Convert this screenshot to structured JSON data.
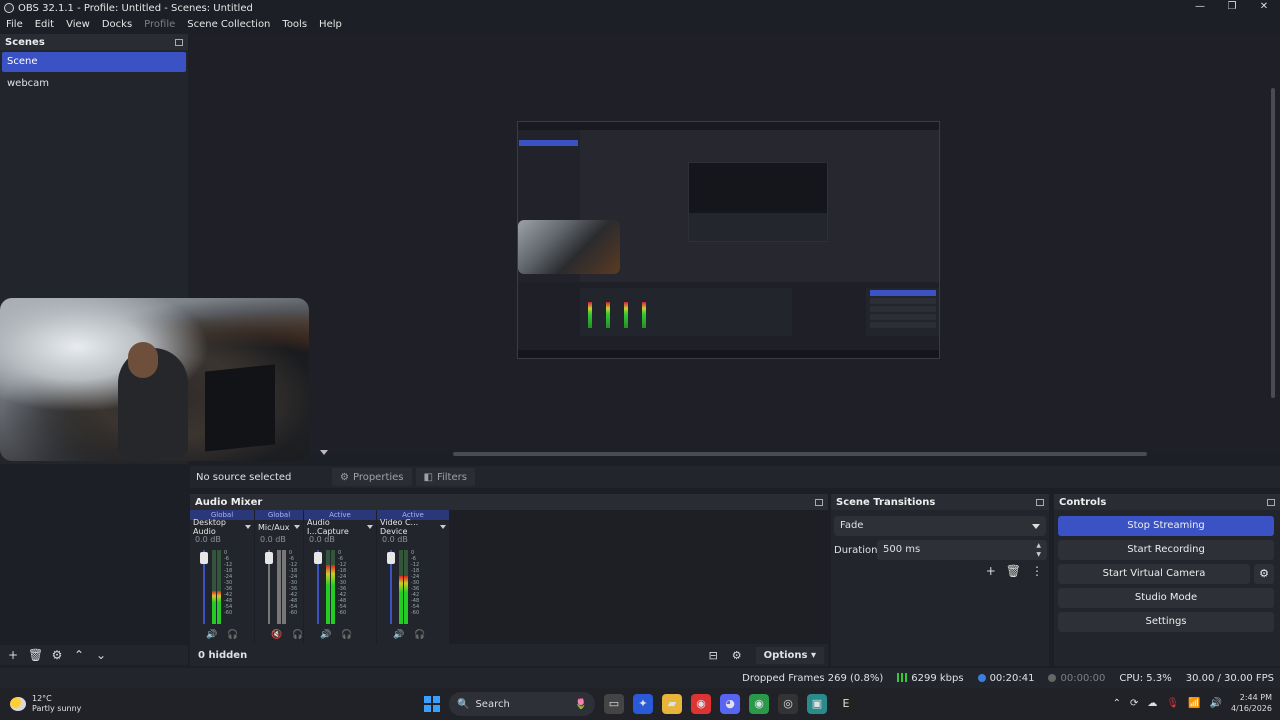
{
  "window": {
    "title": "OBS 32.1.1 - Profile: Untitled - Scenes: Untitled",
    "controls": [
      "—",
      "❐",
      "✕"
    ]
  },
  "menu": [
    "File",
    "Edit",
    "View",
    "Docks",
    "Profile",
    "Scene Collection",
    "Tools",
    "Help"
  ],
  "scenes": {
    "header": "Scenes",
    "items": [
      "Scene",
      "webcam"
    ],
    "active_index": 0
  },
  "sources_bar": {
    "no_source": "No source selected",
    "properties": "Properties",
    "filters": "Filters"
  },
  "mixer": {
    "header": "Audio Mixer",
    "channels": [
      {
        "badge": "Global",
        "name": "Desktop Audio",
        "db": "0.0 dB",
        "level_pct": 45,
        "muted": false
      },
      {
        "badge": "Global",
        "name": "Mic/Aux",
        "db": "0.0 dB",
        "level_pct": 0,
        "muted": true
      },
      {
        "badge": "Active",
        "name": "Audio I...Capture",
        "db": "0.0 dB",
        "level_pct": 80,
        "muted": false
      },
      {
        "badge": "Active",
        "name": "Video C... Device",
        "db": "0.0 dB",
        "level_pct": 65,
        "muted": false
      }
    ],
    "scale": [
      "0",
      "-6",
      "-12",
      "-18",
      "-24",
      "-30",
      "-36",
      "-42",
      "-48",
      "-54",
      "-60"
    ],
    "hidden": "0 hidden",
    "options": "Options"
  },
  "transitions": {
    "header": "Scene Transitions",
    "selected": "Fade",
    "duration_label": "Duration",
    "duration_value": "500 ms"
  },
  "controls": {
    "header": "Controls",
    "stop_streaming": "Stop Streaming",
    "start_recording": "Start Recording",
    "start_virtual_camera": "Start Virtual Camera",
    "studio_mode": "Studio Mode",
    "settings": "Settings"
  },
  "status": {
    "dropped_frames": "Dropped Frames 269 (0.8%)",
    "kbps": "6299 kbps",
    "stream_time": "00:20:41",
    "record_time": "00:00:00",
    "cpu": "CPU: 5.3%",
    "fps": "30.00 / 30.00 FPS"
  },
  "taskbar": {
    "temp": "12°C",
    "weather": "Partly sunny",
    "search": "Search",
    "time": "2:44 PM",
    "date": "4/16/2026"
  }
}
